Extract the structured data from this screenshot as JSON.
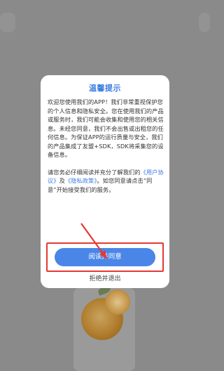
{
  "dialog": {
    "title": "温馨提示",
    "paragraph1": "欢迎您使用我们的APP！我们非常重视保护您的个人信息和隐私安全。您在使用我们的产品或服务时，我们可能会收集和使用您的相关信息。未经您同意，我们不会出售或出租您的任何信息。为保证APP的运行质量与安全，我们的产品集成了友盟+SDK，SDK将采集您的设备信息。",
    "p2_prefix": "请您务必仔细阅读并充分了解我们的",
    "user_agreement_link": "《用户协议》",
    "p2_and": "及",
    "privacy_policy_link": "《隐私政策》",
    "p2_suffix": "。如您同意请点击“同意”开始接受我们的服务。",
    "agree_button": "阅读并同意",
    "reject_button": "拒绝并退出"
  },
  "colors": {
    "accent": "#4a86e8",
    "title": "#3d7ee0",
    "highlight": "#e53935",
    "overlay": "#8a8a8a"
  }
}
